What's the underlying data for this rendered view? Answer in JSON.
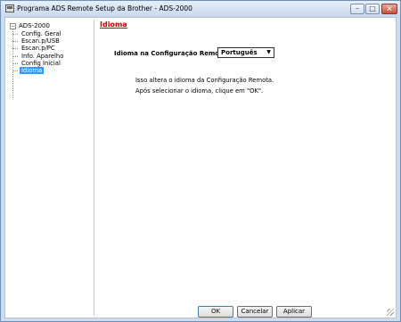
{
  "window": {
    "title": "Programa ADS Remote Setup da Brother - ADS-2000"
  },
  "tree": {
    "root": "ADS-2000",
    "items": [
      {
        "label": "Config. Geral"
      },
      {
        "label": "Escan.p/USB"
      },
      {
        "label": "Escan.p/PC"
      },
      {
        "label": "Info. Aparelho"
      },
      {
        "label": "Config Inicial"
      },
      {
        "label": "Idioma",
        "selected": true
      }
    ]
  },
  "main": {
    "section_title": "Idioma",
    "setting_label": "Idioma na Configuração Remota",
    "language_select_value": "Português",
    "info_line1": "Isso altera o idioma da Configuração Remota.",
    "info_line2": "Após selecionar o idioma, clique em \"OK\"."
  },
  "buttons": {
    "ok": "OK",
    "cancel": "Cancelar",
    "apply": "Aplicar"
  }
}
